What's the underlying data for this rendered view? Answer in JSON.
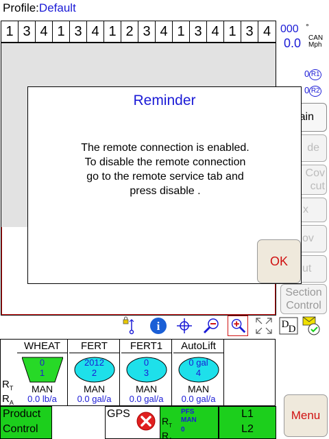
{
  "profile": {
    "label": "Profile:",
    "value": "Default"
  },
  "row_numbers": [
    "1",
    "3",
    "4",
    "1",
    "3",
    "4",
    "1",
    "2",
    "3",
    "4",
    "1",
    "3",
    "4",
    "1",
    "3",
    "4"
  ],
  "speed": {
    "heading": "000",
    "deg": "°",
    "value": "0.0",
    "can": "CAN",
    "unit": "Mph"
  },
  "rate_indicators": [
    {
      "value": "0",
      "badge": "R1"
    },
    {
      "value": "0",
      "badge": "R2"
    }
  ],
  "side_buttons": [
    "ain",
    "de",
    "Cov\ncut",
    "x",
    "ov",
    "ut",
    "Section\nControl"
  ],
  "dialog": {
    "title": "Reminder",
    "message": [
      "The remote connection is enabled.",
      "To disable the remote connection",
      "go to the remote service tab and",
      "press disable ."
    ],
    "ok": "OK"
  },
  "toolbar": {
    "icons": [
      "lock-icon",
      "info-icon",
      "target-icon",
      "zoom-out-icon",
      "zoom-in-icon",
      "fullscreen-icon",
      "dd-icon",
      "message-icon"
    ],
    "dd_text": "D"
  },
  "rt_label": {
    "r": "R",
    "t": "T",
    "a": "A"
  },
  "products": [
    {
      "name": "WHEAT",
      "line1": "0",
      "line2": "1",
      "mode": "MAN",
      "rate": "0.0 lb/a",
      "shape": "trapezoid",
      "fill": "#27d927"
    },
    {
      "name": "FERT",
      "line1": "2012",
      "line2": "2",
      "mode": "MAN",
      "rate": "0.0 gal/a",
      "shape": "ellipse",
      "fill": "#1ee0ea"
    },
    {
      "name": "FERT1",
      "line1": "0",
      "line2": "3",
      "mode": "MAN",
      "rate": "0.0 gal/a",
      "shape": "ellipse",
      "fill": "#1ee0ea"
    },
    {
      "name": "AutoLift",
      "line1": "0 gal",
      "line2": "4",
      "mode": "MAN",
      "rate": "0.0 gal/a",
      "shape": "ellipse",
      "fill": "#1ee0ea"
    }
  ],
  "bottom": {
    "product_control": [
      "Product",
      "Control"
    ],
    "gps": "GPS",
    "pfs": "PFS",
    "man": "MAN",
    "zero": "0",
    "l1": "L1",
    "l2": "L2",
    "menu": "Menu"
  },
  "colors": {
    "accent_blue": "#1a1ad6",
    "status_green": "#1ccf1c",
    "alert_red": "#d01010"
  }
}
